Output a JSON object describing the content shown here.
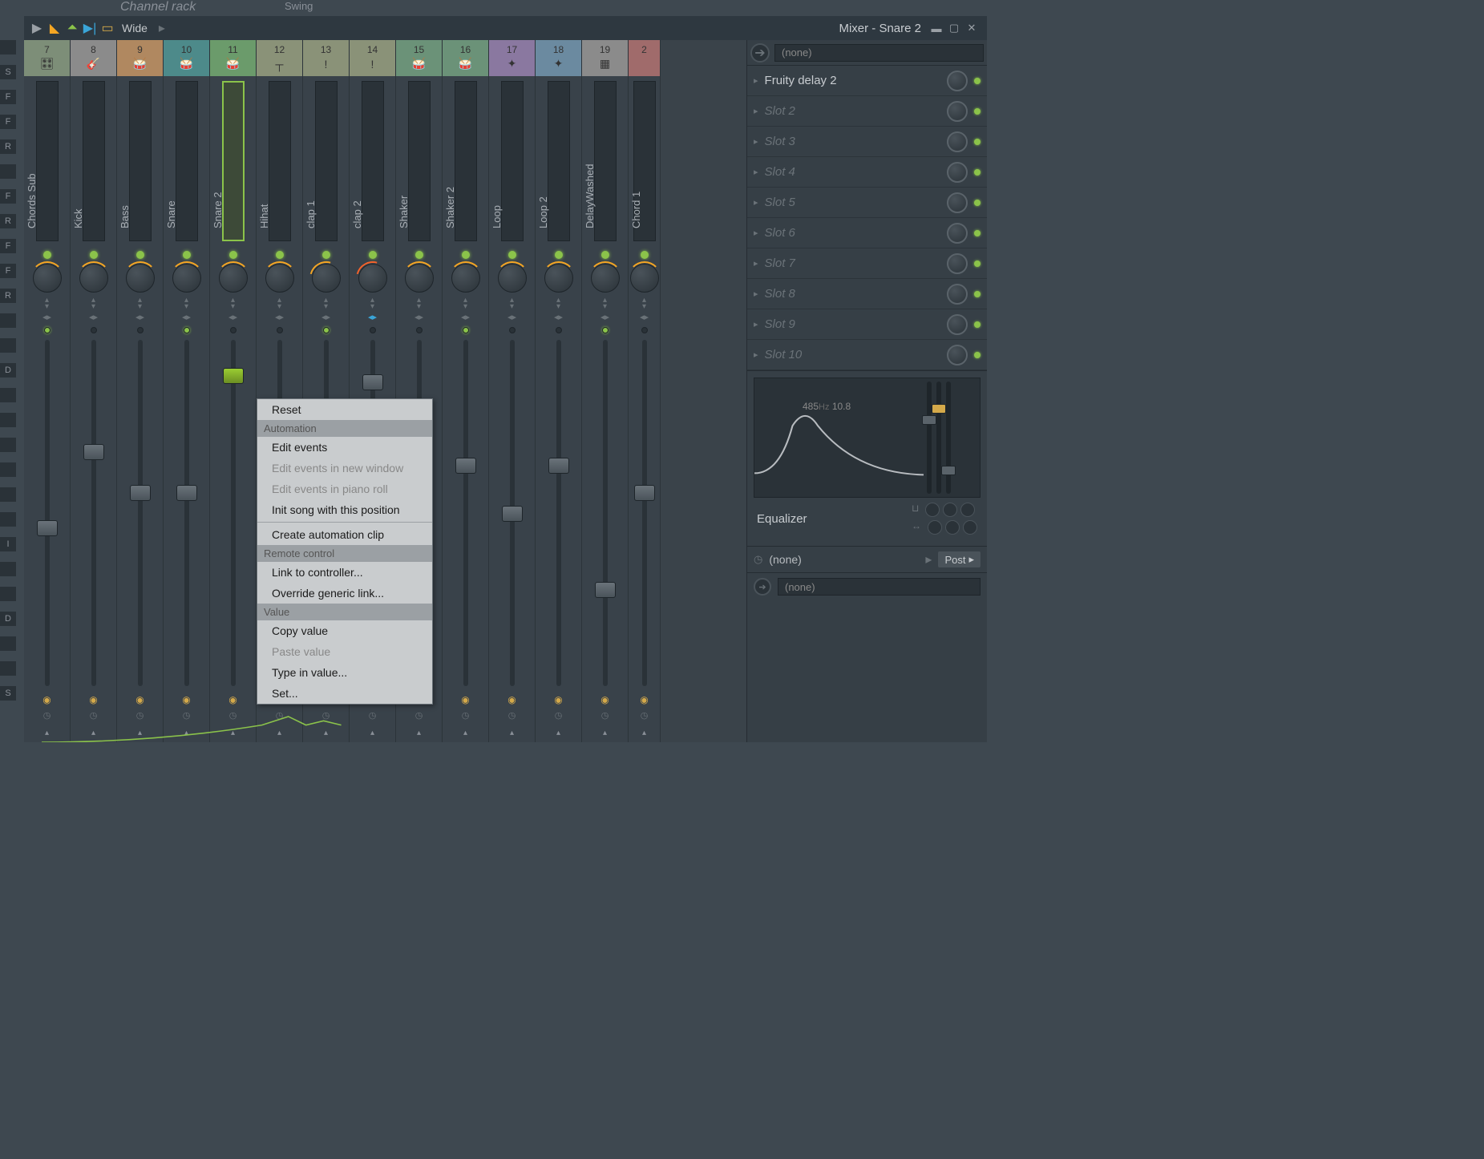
{
  "bgHints": {
    "channel": "Channel rack",
    "swing": "Swing"
  },
  "window": {
    "title": "Mixer - Snare 2",
    "view": "Wide"
  },
  "tracks": [
    {
      "num": "7",
      "name": "Chords Sub",
      "color": "#7d8e78",
      "icon": "🎛",
      "fader": 52
    },
    {
      "num": "8",
      "name": "Kick",
      "color": "#8b8b8b",
      "icon": "🎸",
      "fader": 30
    },
    {
      "num": "9",
      "name": "Bass",
      "color": "#b08860",
      "icon": "🥁",
      "fader": 42
    },
    {
      "num": "10",
      "name": "Snare",
      "color": "#4d8a8a",
      "icon": "🥁",
      "fader": 42
    },
    {
      "num": "11",
      "name": "Snare 2",
      "color": "#6b9b6b",
      "icon": "🥁",
      "fader": 8,
      "selected": true,
      "faderGreen": true
    },
    {
      "num": "12",
      "name": "Hihat",
      "color": "#8a9278",
      "icon": "┬",
      "fader": 34
    },
    {
      "num": "13",
      "name": "clap 1",
      "color": "#8a9278",
      "icon": "!",
      "fader": 36,
      "arc": "#f5a623"
    },
    {
      "num": "14",
      "name": "clap 2",
      "color": "#8a9278",
      "icon": "!",
      "fader": 10,
      "arc": "#f5622a",
      "blueLR": true
    },
    {
      "num": "15",
      "name": "Shaker",
      "color": "#6b9278",
      "icon": "🥁",
      "fader": 36
    },
    {
      "num": "16",
      "name": "Shaker 2",
      "color": "#6b9278",
      "icon": "🥁",
      "fader": 34
    },
    {
      "num": "17",
      "name": "Loop",
      "color": "#8a78a0",
      "icon": "✦",
      "fader": 48
    },
    {
      "num": "18",
      "name": "Loop 2",
      "color": "#6b8aa0",
      "icon": "✦",
      "fader": 34
    },
    {
      "num": "19",
      "name": "DelayWashed",
      "color": "#8b8b8b",
      "icon": "▦",
      "fader": 70
    },
    {
      "num": "2",
      "name": "Chord 1",
      "color": "#a06b6b",
      "icon": "",
      "fader": 42,
      "cut": true
    }
  ],
  "fxSlots": [
    {
      "name": "Fruity delay 2",
      "empty": false
    },
    {
      "name": "Slot 2",
      "empty": true
    },
    {
      "name": "Slot 3",
      "empty": true
    },
    {
      "name": "Slot 4",
      "empty": true
    },
    {
      "name": "Slot 5",
      "empty": true
    },
    {
      "name": "Slot 6",
      "empty": true
    },
    {
      "name": "Slot 7",
      "empty": true
    },
    {
      "name": "Slot 8",
      "empty": true
    },
    {
      "name": "Slot 9",
      "empty": true
    },
    {
      "name": "Slot 10",
      "empty": true
    }
  ],
  "fxInput": {
    "none": "(none)"
  },
  "eq": {
    "label": "Equalizer",
    "freq": "485",
    "hz": "Hz",
    "gain": "10.8"
  },
  "output": {
    "none": "(none)",
    "post": "Post",
    "none2": "(none)"
  },
  "contextMenu": {
    "reset": "Reset",
    "h1": "Automation",
    "edit": "Edit events",
    "editNewWin": "Edit events in new window",
    "editPiano": "Edit events in piano roll",
    "init": "Init song with this position",
    "create": "Create automation clip",
    "h2": "Remote control",
    "link": "Link to controller...",
    "override": "Override generic link...",
    "h3": "Value",
    "copy": "Copy value",
    "paste": "Paste value",
    "type": "Type in value...",
    "set": "Set..."
  },
  "sideLetters": [
    "",
    "S",
    "F",
    "F",
    "R",
    "",
    "F",
    "R",
    "F",
    "F",
    "R",
    "",
    "",
    "D",
    "",
    "",
    "",
    "",
    "",
    "",
    "I",
    "",
    "",
    "D",
    "",
    "",
    "S"
  ]
}
